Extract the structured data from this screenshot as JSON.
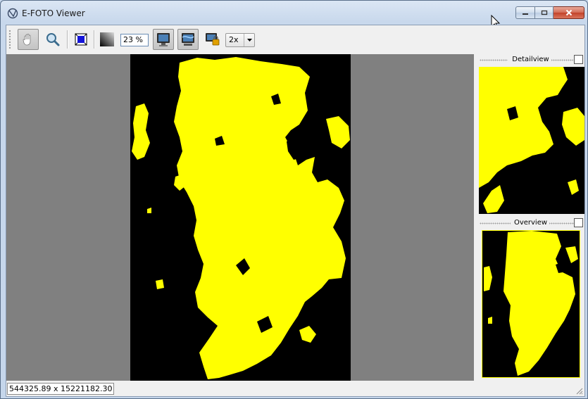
{
  "window": {
    "title": "E-FOTO Viewer"
  },
  "toolbar": {
    "zoom_value": "23 %",
    "combo_value": "2x",
    "tools": [
      {
        "name": "pan-tool",
        "icon": "hand-icon",
        "checked": true
      },
      {
        "name": "zoom-tool",
        "icon": "magnifier-icon",
        "checked": false
      },
      {
        "name": "fit-view",
        "icon": "fit-view-icon",
        "checked": false
      },
      {
        "name": "contrast",
        "icon": "gradient-icon",
        "checked": false
      },
      {
        "name": "detail-view-toggle",
        "icon": "monitor-icon",
        "checked": true
      },
      {
        "name": "overview-toggle",
        "icon": "monitor-network-icon",
        "checked": true
      },
      {
        "name": "lock-view",
        "icon": "monitor-lock-icon",
        "checked": false
      }
    ]
  },
  "docks": {
    "detail": {
      "title": "Detailview"
    },
    "overview": {
      "title": "Overview"
    }
  },
  "status": {
    "coords": "544325.89 x 15221182.30"
  },
  "colors": {
    "raster_fill": "#ffff00",
    "background": "#000000",
    "canvas": "#808080"
  }
}
